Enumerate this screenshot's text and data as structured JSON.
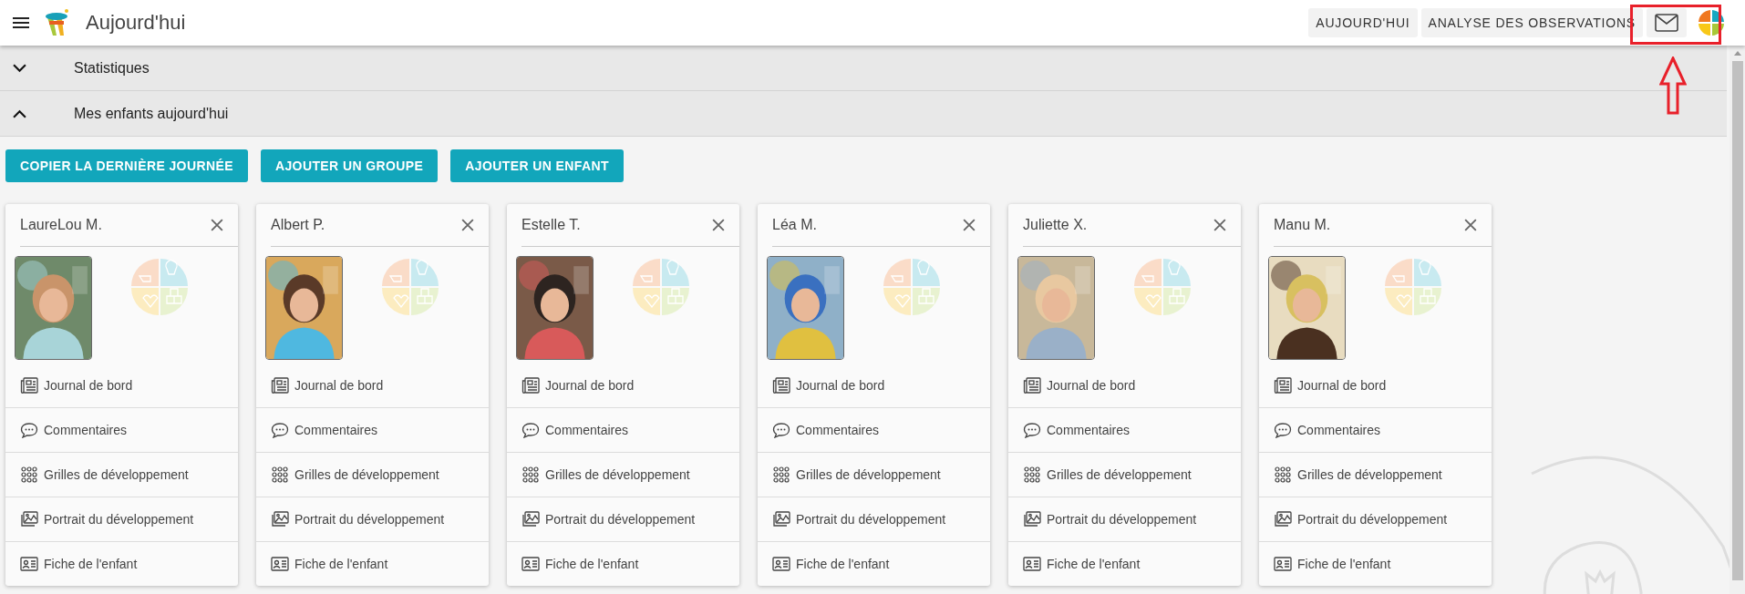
{
  "app_bar": {
    "title": "Aujourd'hui",
    "nav": [
      {
        "label": "AUJOURD'HUI"
      },
      {
        "label": "ANALYSE DES OBSERVATIONS"
      }
    ]
  },
  "sections": [
    {
      "label": "Statistiques",
      "expanded": false
    },
    {
      "label": "Mes enfants aujourd'hui",
      "expanded": true
    }
  ],
  "actions": [
    "COPIER LA DERNIÈRE JOURNÉE",
    "AJOUTER UN GROUPE",
    "AJOUTER UN ENFANT"
  ],
  "children": [
    {
      "name": "LaureLou M.",
      "links": [
        {
          "kind": "journal",
          "label": "Journal de bord"
        },
        {
          "kind": "comments",
          "label": "Commentaires"
        },
        {
          "kind": "grid",
          "label": "Grilles de développement"
        },
        {
          "kind": "portrait",
          "label": "Portrait du développement"
        },
        {
          "kind": "card",
          "label": "Fiche de l'enfant"
        }
      ]
    },
    {
      "name": "Albert P.",
      "links": [
        {
          "kind": "journal",
          "label": "Journal de bord"
        },
        {
          "kind": "comments",
          "label": "Commentaires"
        },
        {
          "kind": "grid",
          "label": "Grilles de développement"
        },
        {
          "kind": "portrait",
          "label": "Portrait du développement"
        },
        {
          "kind": "card",
          "label": "Fiche de l'enfant"
        }
      ]
    },
    {
      "name": "Estelle T.",
      "links": [
        {
          "kind": "journal",
          "label": "Journal de bord"
        },
        {
          "kind": "comments",
          "label": "Commentaires"
        },
        {
          "kind": "grid",
          "label": "Grilles de développement"
        },
        {
          "kind": "portrait",
          "label": "Portrait du développement"
        },
        {
          "kind": "card",
          "label": "Fiche de l'enfant"
        }
      ]
    },
    {
      "name": "Léa M.",
      "links": [
        {
          "kind": "journal",
          "label": "Journal de bord"
        },
        {
          "kind": "comments",
          "label": "Commentaires"
        },
        {
          "kind": "grid",
          "label": "Grilles de développement"
        },
        {
          "kind": "portrait",
          "label": "Portrait du développement"
        },
        {
          "kind": "card",
          "label": "Fiche de l'enfant"
        }
      ]
    },
    {
      "name": "Juliette X.",
      "links": [
        {
          "kind": "journal",
          "label": "Journal de bord"
        },
        {
          "kind": "comments",
          "label": "Commentaires"
        },
        {
          "kind": "grid",
          "label": "Grilles de développement"
        },
        {
          "kind": "portrait",
          "label": "Portrait du développement"
        },
        {
          "kind": "card",
          "label": "Fiche de l'enfant"
        }
      ]
    },
    {
      "name": "Manu M.",
      "links": [
        {
          "kind": "journal",
          "label": "Journal de bord"
        },
        {
          "kind": "comments",
          "label": "Commentaires"
        },
        {
          "kind": "grid",
          "label": "Grilles de développement"
        },
        {
          "kind": "portrait",
          "label": "Portrait du développement"
        },
        {
          "kind": "card",
          "label": "Fiche de l'enfant"
        }
      ]
    }
  ]
}
